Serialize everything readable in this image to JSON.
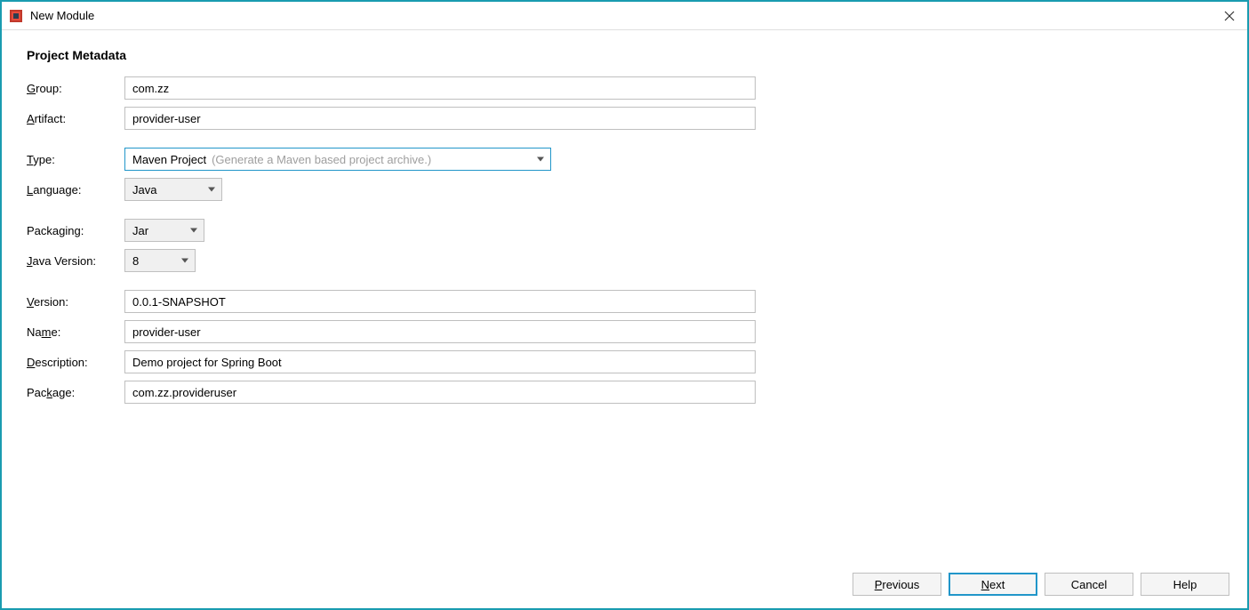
{
  "window": {
    "title": "New Module"
  },
  "section": {
    "title": "Project Metadata"
  },
  "labels": {
    "group": "Group:",
    "artifact": "Artifact:",
    "type": "Type:",
    "language": "Language:",
    "packaging": "Packaging:",
    "javaVersion": "Java Version:",
    "version": "Version:",
    "name": "Name:",
    "description": "Description:",
    "package": "Package:"
  },
  "fields": {
    "group": "com.zz",
    "artifact": "provider-user",
    "type": "Maven Project",
    "typeHint": "(Generate a Maven based project archive.)",
    "language": "Java",
    "packaging": "Jar",
    "javaVersion": "8",
    "version": "0.0.1-SNAPSHOT",
    "name": "provider-user",
    "description": "Demo project for Spring Boot",
    "package": "com.zz.provideruser"
  },
  "buttons": {
    "previous": "revious",
    "previousMn": "P",
    "next": "ext",
    "nextMn": "N",
    "cancel": "Cancel",
    "help": "Help"
  }
}
